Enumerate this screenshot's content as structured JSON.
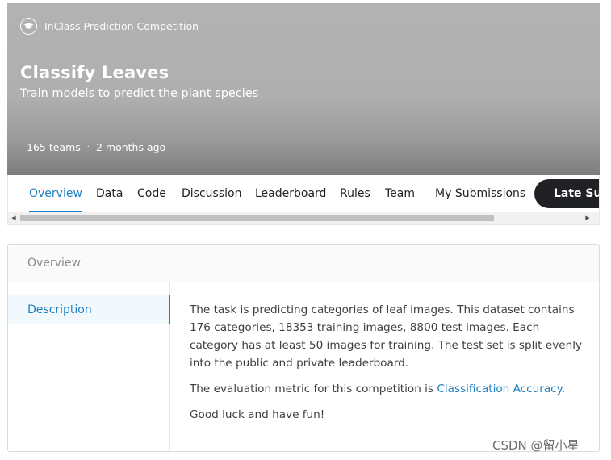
{
  "header": {
    "competition_type": "InClass Prediction Competition",
    "competition_icon": "graduation-cap-icon",
    "title": "Classify Leaves",
    "subtitle": "Train models to predict the plant species",
    "teams": "165 teams",
    "separator": "·",
    "age": "2 months ago"
  },
  "tabs": [
    {
      "label": "Overview",
      "active": true
    },
    {
      "label": "Data"
    },
    {
      "label": "Code"
    },
    {
      "label": "Discussion"
    },
    {
      "label": "Leaderboard"
    },
    {
      "label": "Rules"
    },
    {
      "label": "Team"
    },
    {
      "label": "My Submissions"
    }
  ],
  "late_submission_button": "Late Su",
  "panel": {
    "header": "Overview",
    "nav": [
      {
        "label": "Description",
        "active": true
      }
    ],
    "description": {
      "paragraph1": "The task is predicting categories of leaf images. This dataset contains 176 categories, 18353 training images, 8800 test images. Each category has at least 50 images for training. The test set is split evenly into the public and private leaderboard.",
      "metric_prefix": "The evaluation metric for this competition is ",
      "metric_link": "Classification Accuracy",
      "metric_suffix": ".",
      "closing": "Good luck and have fun!"
    }
  },
  "watermark": "CSDN @留小星",
  "colors": {
    "accent": "#1c7fc2",
    "banner": "#afafaf",
    "button_dark": "#202124"
  }
}
